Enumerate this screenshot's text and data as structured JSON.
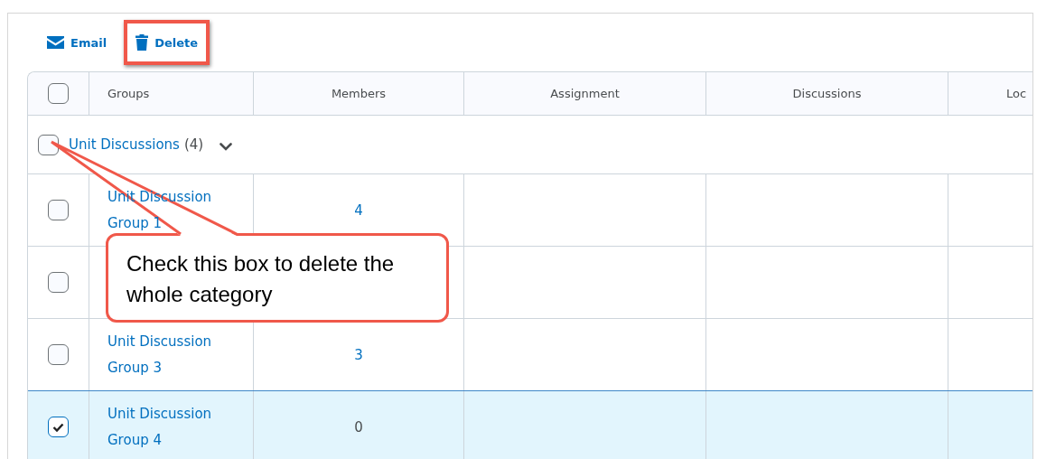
{
  "toolbar": {
    "buttons": [
      {
        "label": "Email",
        "kind": "email",
        "highlighted": false
      },
      {
        "label": "Delete",
        "kind": "delete",
        "highlighted": true
      }
    ]
  },
  "table": {
    "select_all": {
      "checked": false
    },
    "columns": [
      "Groups",
      "Members",
      "Assignment",
      "Discussions",
      "Loc"
    ],
    "category": {
      "name": "Unit Discussions",
      "count": "(4)",
      "checked": false,
      "expanded": true
    },
    "rows": [
      {
        "name": "Unit Discussion Group 1",
        "members": "4",
        "linked": true,
        "selected": false
      },
      {
        "selected": false
      },
      {
        "name": "Unit Discussion Group 3",
        "members": "3",
        "linked": true,
        "selected": false
      },
      {
        "name": "Unit Discussion Group 4",
        "members": "0",
        "linked": false,
        "selected": true
      }
    ]
  },
  "callout": {
    "text": "Check this box to delete the whole category"
  }
}
